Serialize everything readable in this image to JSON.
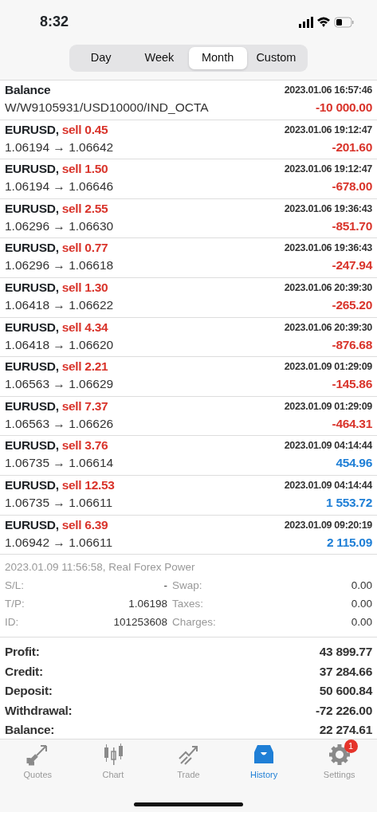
{
  "status_bar": {
    "time": "8:32"
  },
  "segments": [
    {
      "label": "Day",
      "selected": false
    },
    {
      "label": "Week",
      "selected": false
    },
    {
      "label": "Month",
      "selected": true
    },
    {
      "label": "Custom",
      "selected": false
    }
  ],
  "balance_entry": {
    "title": "Balance",
    "comment": "W/W9105931/USD10000/IND_OCTA",
    "time": "2023.01.06 16:57:46",
    "amount": "-10 000.00",
    "color": "#d9342b"
  },
  "deals": [
    {
      "symbol": "EURUSD,",
      "action": "sell 0.45",
      "prices": "1.06194 → 1.06642",
      "time": "2023.01.06 19:12:47",
      "amount": "-201.60",
      "color": "#d9342b"
    },
    {
      "symbol": "EURUSD,",
      "action": "sell 1.50",
      "prices": "1.06194 → 1.06646",
      "time": "2023.01.06 19:12:47",
      "amount": "-678.00",
      "color": "#d9342b"
    },
    {
      "symbol": "EURUSD,",
      "action": "sell 2.55",
      "prices": "1.06296 → 1.06630",
      "time": "2023.01.06 19:36:43",
      "amount": "-851.70",
      "color": "#d9342b"
    },
    {
      "symbol": "EURUSD,",
      "action": "sell 0.77",
      "prices": "1.06296 → 1.06618",
      "time": "2023.01.06 19:36:43",
      "amount": "-247.94",
      "color": "#d9342b"
    },
    {
      "symbol": "EURUSD,",
      "action": "sell 1.30",
      "prices": "1.06418 → 1.06622",
      "time": "2023.01.06 20:39:30",
      "amount": "-265.20",
      "color": "#d9342b"
    },
    {
      "symbol": "EURUSD,",
      "action": "sell 4.34",
      "prices": "1.06418 → 1.06620",
      "time": "2023.01.06 20:39:30",
      "amount": "-876.68",
      "color": "#d9342b"
    },
    {
      "symbol": "EURUSD,",
      "action": "sell 2.21",
      "prices": "1.06563 → 1.06629",
      "time": "2023.01.09 01:29:09",
      "amount": "-145.86",
      "color": "#d9342b"
    },
    {
      "symbol": "EURUSD,",
      "action": "sell 7.37",
      "prices": "1.06563 → 1.06626",
      "time": "2023.01.09 01:29:09",
      "amount": "-464.31",
      "color": "#d9342b"
    },
    {
      "symbol": "EURUSD,",
      "action": "sell 3.76",
      "prices": "1.06735 → 1.06614",
      "time": "2023.01.09 04:14:44",
      "amount": "454.96",
      "color": "#1f7fd6"
    },
    {
      "symbol": "EURUSD,",
      "action": "sell 12.53",
      "prices": "1.06735 → 1.06611",
      "time": "2023.01.09 04:14:44",
      "amount": "1 553.72",
      "color": "#1f7fd6"
    },
    {
      "symbol": "EURUSD,",
      "action": "sell 6.39",
      "prices": "1.06942 → 1.06611",
      "time": "2023.01.09 09:20:19",
      "amount": "2 115.09",
      "color": "#1f7fd6"
    }
  ],
  "deal_details": {
    "header": "2023.01.09 11:56:58, Real Forex Power",
    "rows": [
      {
        "label": "S/L:",
        "value": "-",
        "label2": "Swap:",
        "value2": "0.00"
      },
      {
        "label": "T/P:",
        "value": "1.06198",
        "label2": "Taxes:",
        "value2": "0.00"
      },
      {
        "label": "ID:",
        "value": "101253608",
        "label2": "Charges:",
        "value2": "0.00"
      }
    ]
  },
  "totals": [
    {
      "label": "Profit:",
      "value": "43 899.77"
    },
    {
      "label": "Credit:",
      "value": "37 284.66"
    },
    {
      "label": "Deposit:",
      "value": "50 600.84"
    },
    {
      "label": "Withdrawal:",
      "value": "-72 226.00"
    },
    {
      "label": "Balance:",
      "value": "22 274.61"
    }
  ],
  "tab_bar": [
    {
      "label": "Quotes",
      "selected": false
    },
    {
      "label": "Chart",
      "selected": false
    },
    {
      "label": "Trade",
      "selected": false
    },
    {
      "label": "History",
      "selected": true
    },
    {
      "label": "Settings",
      "selected": false,
      "badge": "1"
    }
  ]
}
